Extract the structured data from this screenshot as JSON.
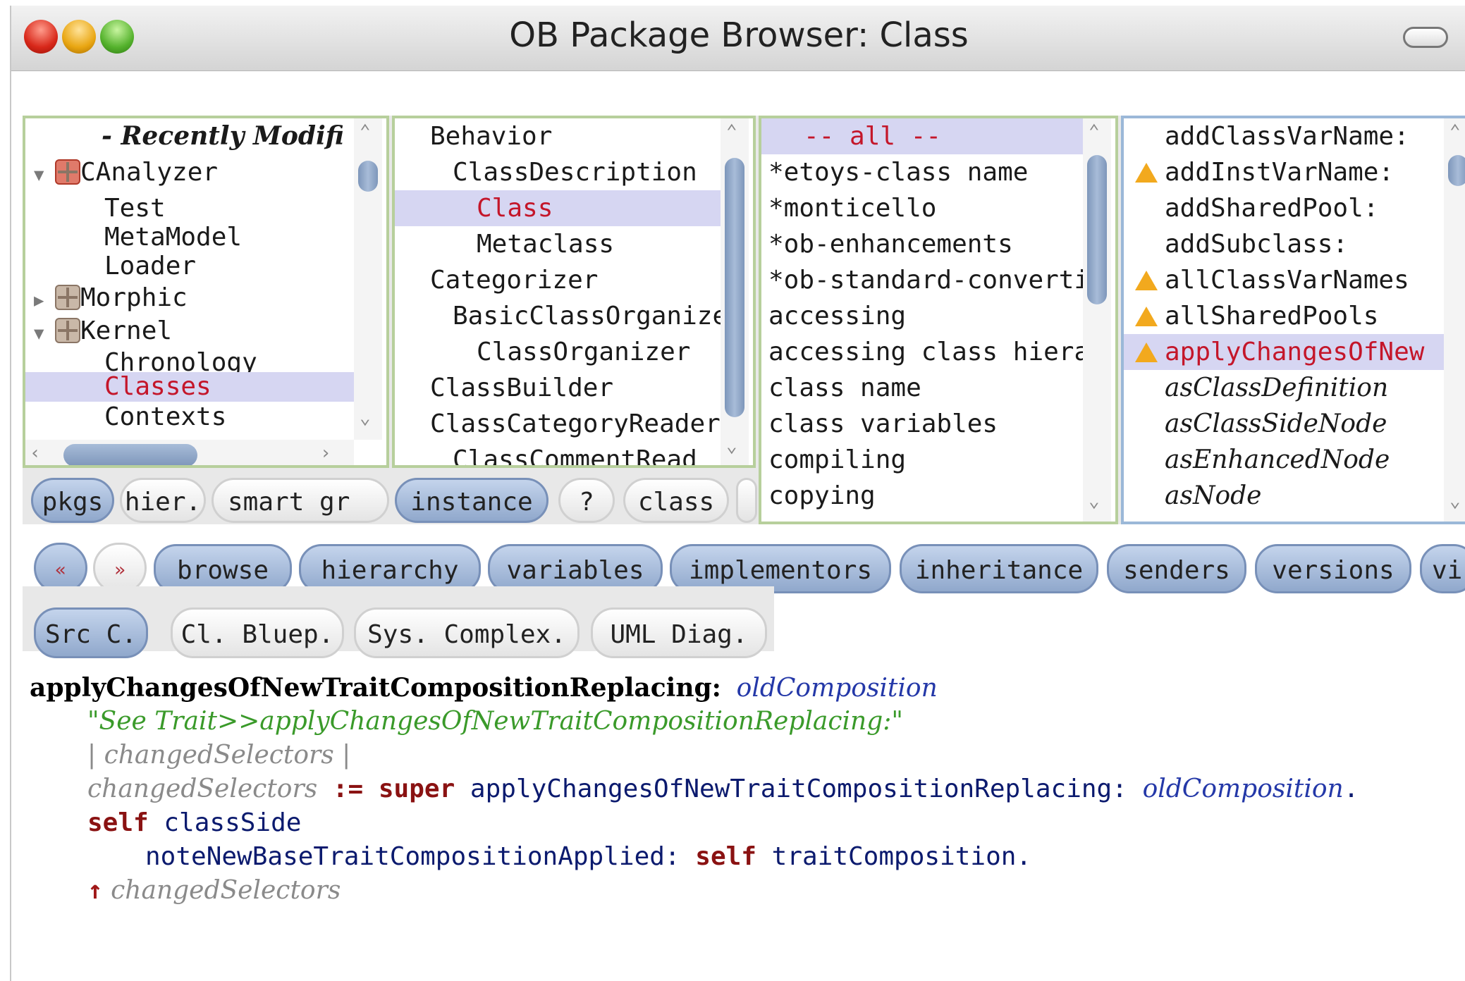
{
  "window": {
    "title": "OB Package Browser: Class"
  },
  "search": {
    "value": ""
  },
  "packages": {
    "header": "- Recently Modifi",
    "items": [
      {
        "label": "CAnalyzer",
        "expanded": true,
        "icon": "package-icon-red"
      },
      {
        "label": "Test"
      },
      {
        "label": "MetaModel"
      },
      {
        "label": "Loader"
      },
      {
        "label": "Morphic",
        "expanded": false,
        "icon": "package-icon"
      },
      {
        "label": "Kernel",
        "expanded": true,
        "icon": "package-icon"
      },
      {
        "label": "Chronology"
      },
      {
        "label": "Classes",
        "selected": true
      },
      {
        "label": "Contexts"
      }
    ],
    "expand_glyph": "▼",
    "collapse_glyph": "▶",
    "buttons": [
      "pkgs",
      "hier.",
      "smart gr"
    ]
  },
  "classes": {
    "items": [
      "Behavior",
      "ClassDescription",
      "Class",
      "Metaclass",
      "Categorizer",
      "BasicClassOrganize",
      "ClassOrganizer",
      "ClassBuilder",
      "ClassCategoryReader",
      "ClassCommentRead"
    ],
    "selected": "Class",
    "buttons": [
      "instance",
      "?",
      "class"
    ]
  },
  "categories": {
    "items": [
      "-- all --",
      "*etoys-class name",
      "*monticello",
      "*ob-enhancements",
      "*ob-standard-convertir",
      "accessing",
      "accessing class hierar",
      "class name",
      "class variables",
      "compiling",
      "copying"
    ]
  },
  "methods": {
    "items": [
      "addClassVarName:",
      "addInstVarName:",
      "addSharedPool:",
      "addSubclass:",
      "allClassVarNames",
      "allSharedPools",
      "applyChangesOfNew",
      "asClassDefinition",
      "asClassSideNode",
      "asEnhancedNode",
      "asNode"
    ],
    "selected": "applyChangesOfNew"
  },
  "toolbar": {
    "back": "«",
    "forward": "»",
    "buttons": [
      "browse",
      "hierarchy",
      "variables",
      "implementors",
      "inheritance",
      "senders",
      "versions",
      "vi"
    ],
    "views": [
      "Src C.",
      "Cl. Bluep.",
      "Sys. Complex.",
      "UML Diag."
    ]
  },
  "code": {
    "header_selector": "applyChangesOfNewTraitCompositionReplacing:",
    "header_arg": "oldComposition",
    "comment": "\"See Trait>>applyChangesOfNewTraitCompositionReplacing:\"",
    "temps": "| changedSelectors |",
    "l4_var": "changedSelectors",
    "l4_assign": " := ",
    "l4_super": "super",
    "l4_msg": " applyChangesOfNewTraitCompositionReplacing: ",
    "l4_arg": "oldComposition",
    "l4_end": ".",
    "l5_self": "self",
    "l5_msg": " classSide",
    "l6_msg": "noteNewBaseTraitCompositionApplied: ",
    "l6_self": "self",
    "l6_end": " traitComposition.",
    "l7_caret": "↑",
    "l7_var": " changedSelectors"
  },
  "colors": {
    "selection_bg": "#d6d6f2",
    "selection_text": "#c4162a",
    "pane_border": "#b7cf9c",
    "pill_blue": "#90a8cc"
  }
}
